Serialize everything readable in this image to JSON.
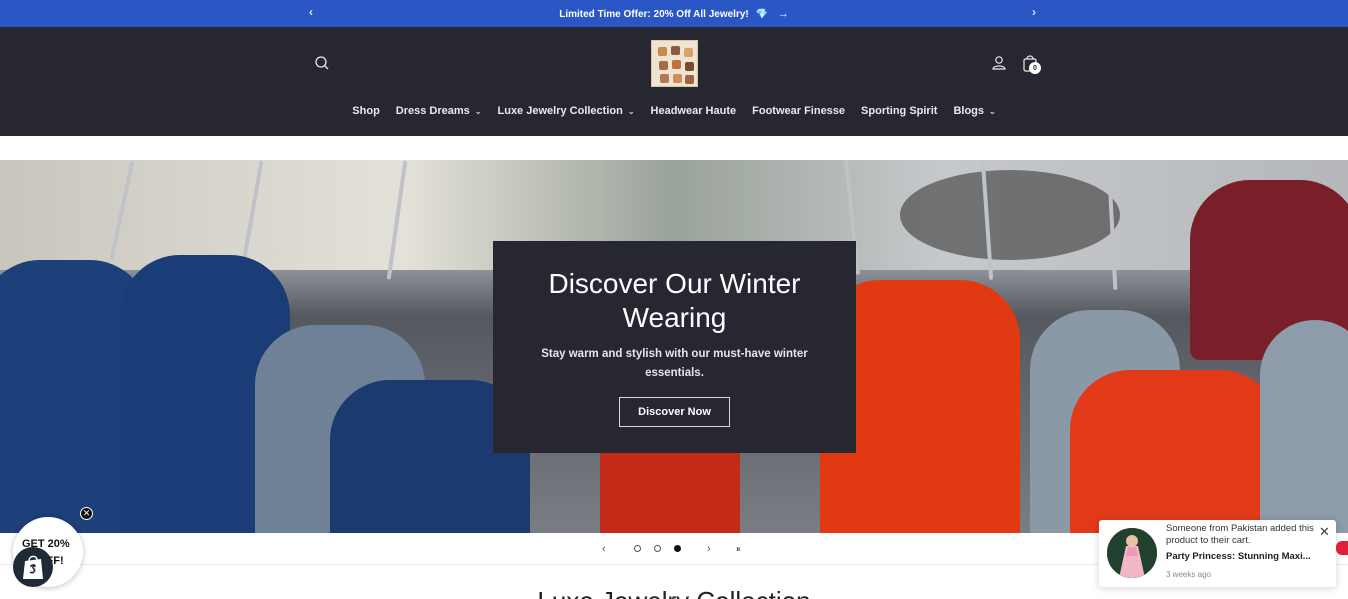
{
  "announcement": {
    "text": "Limited Time Offer: 20% Off All Jewelry!",
    "gem": "💎",
    "link_arrow": "→",
    "prev": "‹",
    "next": "›"
  },
  "header": {
    "logo_alt": "Store logo",
    "cart_count": "0",
    "nav": [
      {
        "label": "Shop",
        "dropdown": false
      },
      {
        "label": "Dress Dreams",
        "dropdown": true
      },
      {
        "label": "Luxe Jewelry Collection",
        "dropdown": true
      },
      {
        "label": "Headwear Haute",
        "dropdown": false
      },
      {
        "label": "Footwear Finesse",
        "dropdown": false
      },
      {
        "label": "Sporting Spirit",
        "dropdown": false
      },
      {
        "label": "Blogs",
        "dropdown": true
      }
    ],
    "chevron": "⌄"
  },
  "hero": {
    "title": "Discover Our Winter Wearing",
    "subtitle": "Stay warm and stylish with our must-have winter essentials.",
    "button": "Discover Now"
  },
  "slider": {
    "prev": "‹",
    "next": "›",
    "pause": "⏸",
    "active_slide": 3,
    "total_slides": 3
  },
  "section": {
    "heading": "Luxe Jewelry Collection"
  },
  "discount_badge": {
    "line1": "GET 20%",
    "line2": "OFF!",
    "close": "✕"
  },
  "notification": {
    "message": "Someone from Pakistan added this product to their cart.",
    "product": "Party Princess: Stunning Maxi...",
    "time": "3 weeks ago",
    "close": "✕"
  },
  "colors": {
    "announce_bg": "#2a56c6",
    "header_bg": "#262730",
    "hero_box_bg": "#262730"
  }
}
